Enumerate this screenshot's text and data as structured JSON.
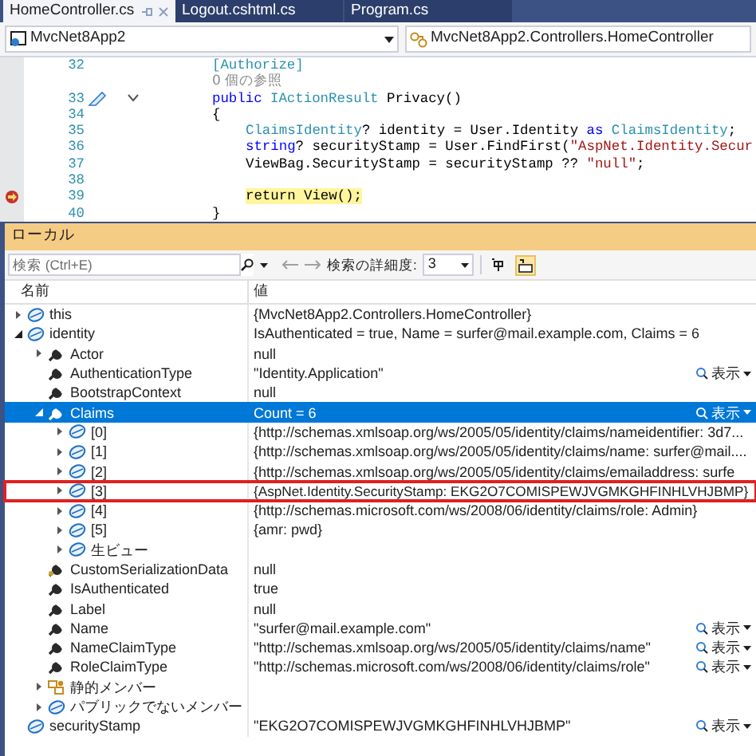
{
  "tabs": [
    {
      "label": "HomeController.cs",
      "selected": true
    },
    {
      "label": "Logout.cshtml.cs",
      "selected": false
    },
    {
      "label": "Program.cs",
      "selected": false
    }
  ],
  "navigation_bar": {
    "project": "MvcNet8App2",
    "class": "MvcNet8App2.Controllers.HomeController"
  },
  "code_lines": [
    {
      "kind": "member",
      "number": "32",
      "breakpoint": false,
      "edited": false,
      "foldable": false,
      "tokens": [
        {
          "kind": "attribute",
          "text": "[Authorize]"
        }
      ]
    },
    {
      "kind": "codelens",
      "breakpoint": false,
      "edited": false,
      "foldable": false,
      "tokens": [
        {
          "kind": "lens",
          "text": "0 個の参照"
        }
      ]
    },
    {
      "kind": "member",
      "number": "33",
      "breakpoint": false,
      "edited": true,
      "foldable": true,
      "tokens": [
        {
          "kind": "keyword",
          "text": "public "
        },
        {
          "kind": "type",
          "text": "IActionResult "
        },
        {
          "kind": "plain",
          "text": "Privacy()"
        }
      ]
    },
    {
      "kind": "member",
      "number": "34",
      "breakpoint": false,
      "edited": false,
      "foldable": false,
      "tokens": [
        {
          "kind": "plain",
          "text": "{"
        }
      ]
    },
    {
      "kind": "statement",
      "number": "35",
      "breakpoint": false,
      "edited": false,
      "foldable": false,
      "tokens": [
        {
          "kind": "type",
          "text": "ClaimsIdentity"
        },
        {
          "kind": "plain",
          "text": "? identity = User.Identity "
        },
        {
          "kind": "keyword",
          "text": "as "
        },
        {
          "kind": "type",
          "text": "ClaimsIdentity"
        },
        {
          "kind": "plain",
          "text": ";"
        }
      ]
    },
    {
      "kind": "statement",
      "number": "36",
      "breakpoint": false,
      "edited": false,
      "foldable": false,
      "tokens": [
        {
          "kind": "keyword",
          "text": "string"
        },
        {
          "kind": "plain",
          "text": "? securityStamp = User.FindFirst("
        },
        {
          "kind": "string",
          "text": "\"AspNet.Identity.Secur"
        }
      ]
    },
    {
      "kind": "statement",
      "number": "37",
      "breakpoint": false,
      "edited": false,
      "foldable": false,
      "tokens": [
        {
          "kind": "plain",
          "text": "ViewBag.SecurityStamp = securityStamp ?? "
        },
        {
          "kind": "string",
          "text": "\"null\""
        },
        {
          "kind": "plain",
          "text": ";"
        }
      ]
    },
    {
      "number": "38",
      "breakpoint": false,
      "edited": false,
      "foldable": false
    },
    {
      "kind": "statement",
      "number": "39",
      "breakpoint": true,
      "edited": false,
      "foldable": false,
      "tokens": [
        {
          "kind": "current",
          "text": "return View();"
        }
      ]
    },
    {
      "kind": "member",
      "number": "40",
      "breakpoint": false,
      "edited": false,
      "foldable": false,
      "tokens": [
        {
          "kind": "plain",
          "text": "}"
        }
      ]
    }
  ],
  "locals": {
    "title": "ローカル",
    "search": {
      "placeholder": "検索 (Ctrl+E)"
    },
    "depth_label": "検索の詳細度:",
    "depth_value": "3",
    "toggles": [
      {
        "selected": false
      },
      {
        "selected": true
      }
    ],
    "columns": [
      "名前",
      "値"
    ],
    "rows": [
      {
        "name": "this",
        "value": "{MvcNet8App2.Controllers.HomeController}",
        "kind": "object",
        "expanded": false,
        "selected": false,
        "outlined": false
      },
      {
        "name": "identity",
        "value": "IsAuthenticated = true, Name = surfer@mail.example.com, Claims = 6",
        "kind": "object",
        "expanded": true,
        "selected": false,
        "outlined": false,
        "children": [
          {
            "name": "Actor",
            "value": "null",
            "kind": "property",
            "expanded": false,
            "selected": false,
            "outlined": false
          },
          {
            "name": "AuthenticationType",
            "value": "\"Identity.Application\"",
            "kind": "property",
            "visualizer": "表示",
            "selected": false,
            "outlined": false
          },
          {
            "name": "BootstrapContext",
            "value": "null",
            "kind": "property",
            "selected": false,
            "outlined": false
          },
          {
            "name": "Claims",
            "value": "Count = 6",
            "kind": "property",
            "expanded": true,
            "visualizer": "表示",
            "selected": true,
            "outlined": false,
            "children": [
              {
                "name": "[0]",
                "value": "{http://schemas.xmlsoap.org/ws/2005/05/identity/claims/nameidentifier: 3d7...",
                "kind": "object",
                "expanded": false,
                "selected": false,
                "outlined": false
              },
              {
                "name": "[1]",
                "value": "{http://schemas.xmlsoap.org/ws/2005/05/identity/claims/name: surfer@mail....",
                "kind": "object",
                "expanded": false,
                "selected": false,
                "outlined": false
              },
              {
                "name": "[2]",
                "value": "{http://schemas.xmlsoap.org/ws/2005/05/identity/claims/emailaddress: surfe",
                "kind": "object",
                "expanded": false,
                "selected": false,
                "outlined": false
              },
              {
                "name": "[3]",
                "value": "{AspNet.Identity.SecurityStamp: EKG2O7COMISPEWJVGMKGHFINHLVHJBMP}",
                "kind": "object",
                "expanded": false,
                "selected": false,
                "outlined": true
              },
              {
                "name": "[4]",
                "value": "{http://schemas.microsoft.com/ws/2008/06/identity/claims/role: Admin}",
                "kind": "object",
                "expanded": false,
                "selected": false,
                "outlined": false
              },
              {
                "name": "[5]",
                "value": "{amr: pwd}",
                "kind": "object",
                "expanded": false,
                "selected": false,
                "outlined": false
              },
              {
                "name": "生ビュー",
                "kind": "object",
                "expanded": false,
                "selected": false,
                "outlined": false
              }
            ]
          },
          {
            "name": "CustomSerializationData",
            "value": "null",
            "kind": "private_property",
            "selected": false,
            "outlined": false
          },
          {
            "name": "IsAuthenticated",
            "value": "true",
            "kind": "property",
            "selected": false,
            "outlined": false
          },
          {
            "name": "Label",
            "value": "null",
            "kind": "property",
            "selected": false,
            "outlined": false
          },
          {
            "name": "Name",
            "value": "\"surfer@mail.example.com\"",
            "kind": "property",
            "visualizer": "表示",
            "selected": false,
            "outlined": false
          },
          {
            "name": "NameClaimType",
            "value": "\"http://schemas.xmlsoap.org/ws/2005/05/identity/claims/name\"",
            "kind": "property",
            "visualizer": "表示",
            "selected": false,
            "outlined": false
          },
          {
            "name": "RoleClaimType",
            "value": "\"http://schemas.microsoft.com/ws/2008/06/identity/claims/role\"",
            "kind": "property",
            "visualizer": "表示",
            "selected": false,
            "outlined": false
          },
          {
            "name": "静的メンバー",
            "kind": "static",
            "expanded": false,
            "selected": false,
            "outlined": false
          },
          {
            "name": "パブリックでないメンバー",
            "kind": "object",
            "expanded": false,
            "selected": false,
            "outlined": false
          }
        ]
      },
      {
        "name": "securityStamp",
        "value": "\"EKG2O7COMISPEWJVGMKGHFINHLVHJBMP\"",
        "kind": "object",
        "visualizer": "表示",
        "selected": false,
        "outlined": false
      }
    ]
  }
}
